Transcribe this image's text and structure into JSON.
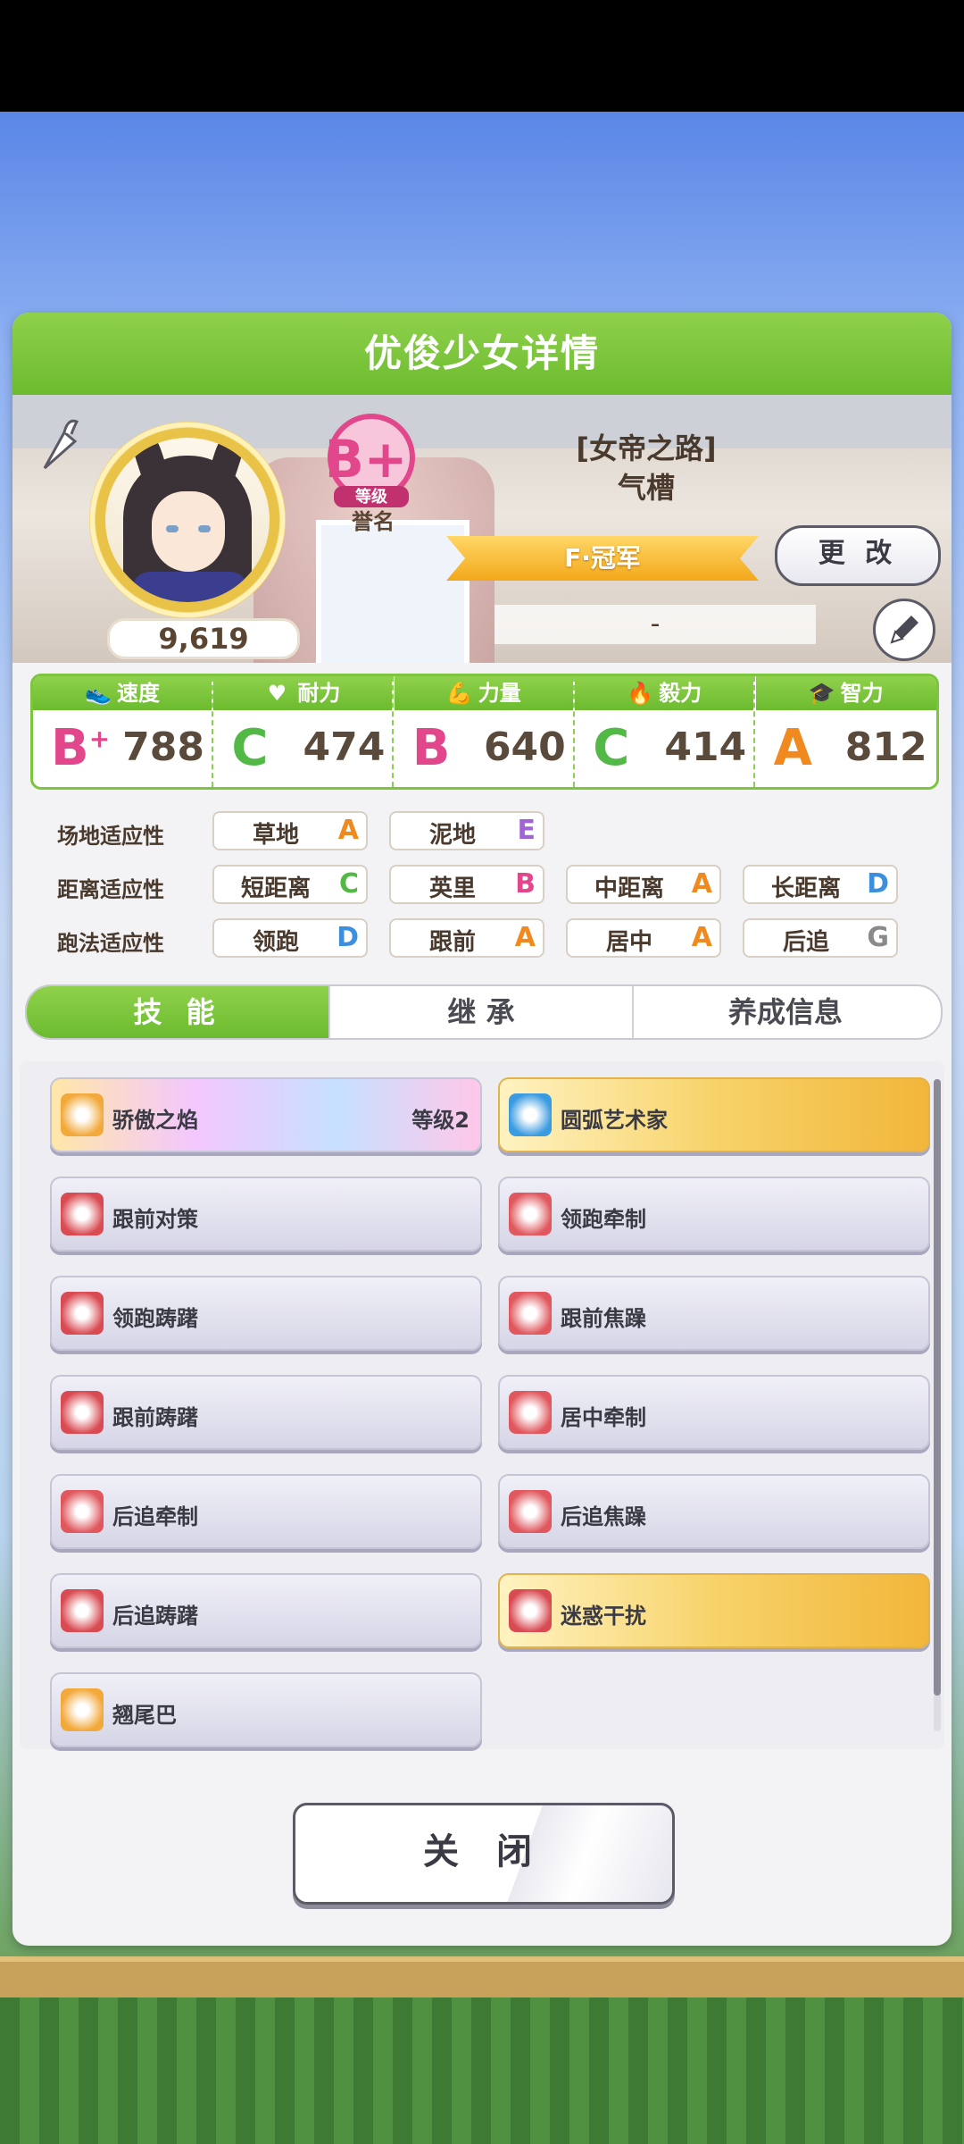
{
  "header": {
    "title": "优俊少女详情"
  },
  "profile": {
    "fans": "9,619",
    "grade": "B+",
    "grade_badge_label": "等级",
    "grade_sub_label": "誉名",
    "epithet_line1": "[女帝之路]",
    "epithet_line2": "气槽",
    "title_ribbon": "F·冠军",
    "change_button": "更 改",
    "dash_value": "-"
  },
  "stats": [
    {
      "label": "速度",
      "grade": "B",
      "grade_plus": "+",
      "value": "788",
      "grade_color": "#e2478c"
    },
    {
      "label": "耐力",
      "grade": "C",
      "grade_plus": "",
      "value": "474",
      "grade_color": "#52b947"
    },
    {
      "label": "力量",
      "grade": "B",
      "grade_plus": "",
      "value": "640",
      "grade_color": "#e2478c"
    },
    {
      "label": "毅力",
      "grade": "C",
      "grade_plus": "",
      "value": "414",
      "grade_color": "#52b947"
    },
    {
      "label": "智力",
      "grade": "A",
      "grade_plus": "",
      "value": "812",
      "grade_color": "#f08a1e"
    }
  ],
  "aptitude": {
    "track_label": "场地适应性",
    "distance_label": "距离适应性",
    "style_label": "跑法适应性",
    "track": [
      {
        "name": "草地",
        "grade": "A",
        "color": "#f08a1e"
      },
      {
        "name": "泥地",
        "grade": "E",
        "color": "#a064d6"
      }
    ],
    "distance": [
      {
        "name": "短距离",
        "grade": "C",
        "color": "#52b947"
      },
      {
        "name": "英里",
        "grade": "B",
        "color": "#e2478c"
      },
      {
        "name": "中距离",
        "grade": "A",
        "color": "#f08a1e"
      },
      {
        "name": "长距离",
        "grade": "D",
        "color": "#3b8fdc"
      }
    ],
    "style": [
      {
        "name": "领跑",
        "grade": "D",
        "color": "#3b8fdc"
      },
      {
        "name": "跟前",
        "grade": "A",
        "color": "#f08a1e"
      },
      {
        "name": "居中",
        "grade": "A",
        "color": "#f08a1e"
      },
      {
        "name": "后追",
        "grade": "G",
        "color": "#8a8a8a"
      }
    ]
  },
  "tabs": [
    {
      "label": "技 能",
      "active": true
    },
    {
      "label": "继 承",
      "active": false
    },
    {
      "label": "养成信息",
      "active": false
    }
  ],
  "skills": [
    {
      "name": "骄傲之焰",
      "level": "等级2",
      "style": "rainbow",
      "icon": "flame-emblem-icon",
      "icon_color": "#f2a93b"
    },
    {
      "name": "圆弧艺术家",
      "level": "",
      "style": "gold",
      "icon": "sparkle-icon",
      "icon_color": "#3b9be0"
    },
    {
      "name": "跟前对策",
      "level": "",
      "style": "normal",
      "icon": "horse-silhouette-icon",
      "icon_color": "#d94b52"
    },
    {
      "name": "领跑牵制",
      "level": "",
      "style": "normal",
      "icon": "debuff-arrow-icon",
      "icon_color": "#e0585e"
    },
    {
      "name": "领跑踌躇",
      "level": "",
      "style": "normal",
      "icon": "horse-silhouette-icon",
      "icon_color": "#d94b52"
    },
    {
      "name": "跟前焦躁",
      "level": "",
      "style": "normal",
      "icon": "debuff-arrow-icon",
      "icon_color": "#e0585e"
    },
    {
      "name": "跟前踌躇",
      "level": "",
      "style": "normal",
      "icon": "horse-silhouette-icon",
      "icon_color": "#d94b52"
    },
    {
      "name": "居中牵制",
      "level": "",
      "style": "normal",
      "icon": "debuff-arrow-icon",
      "icon_color": "#e0585e"
    },
    {
      "name": "后追牵制",
      "level": "",
      "style": "normal",
      "icon": "debuff-arrow-icon",
      "icon_color": "#e0585e"
    },
    {
      "name": "后追焦躁",
      "level": "",
      "style": "normal",
      "icon": "debuff-arrow-icon",
      "icon_color": "#e0585e"
    },
    {
      "name": "后追踌躇",
      "level": "",
      "style": "normal",
      "icon": "horse-silhouette-icon",
      "icon_color": "#d94b52"
    },
    {
      "name": "迷惑干扰",
      "level": "",
      "style": "gold",
      "icon": "runner-icon",
      "icon_color": "#d94b52"
    },
    {
      "name": "翘尾巴",
      "level": "",
      "style": "normal",
      "icon": "flame-emblem-icon",
      "icon_color": "#f2a93b"
    }
  ],
  "close_button": "关 闭"
}
